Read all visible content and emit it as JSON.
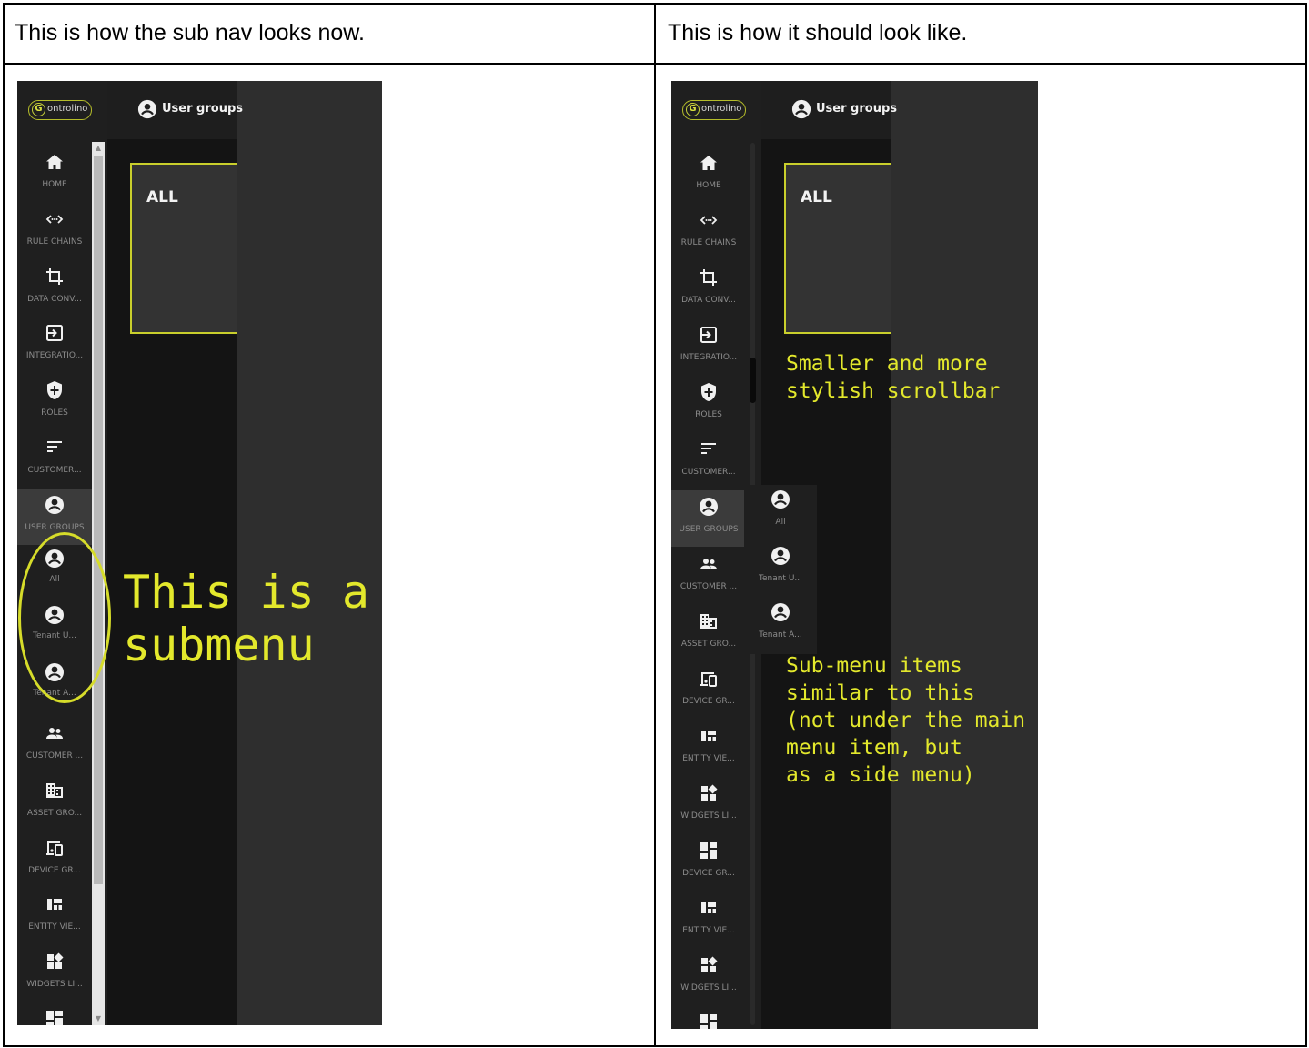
{
  "left_panel": {
    "heading": "This is how the sub nav looks now.",
    "app": {
      "logo_text": "ontrolino",
      "logo_letter": "G",
      "topbar_title": "User groups",
      "card_title": "ALL",
      "nav_items": [
        {
          "label": "HOME",
          "icon": "home-icon"
        },
        {
          "label": "RULE CHAINS",
          "icon": "code-icon"
        },
        {
          "label": "DATA CONV...",
          "icon": "crop-icon"
        },
        {
          "label": "INTEGRATIO...",
          "icon": "input-icon"
        },
        {
          "label": "ROLES",
          "icon": "shield-icon"
        },
        {
          "label": "CUSTOMER...",
          "icon": "sort-icon"
        },
        {
          "label": "USER GROUPS",
          "icon": "account-circle-icon",
          "active": true
        },
        {
          "label": "All",
          "icon": "account-circle-icon"
        },
        {
          "label": "Tenant U...",
          "icon": "account-circle-icon"
        },
        {
          "label": "Tenant A...",
          "icon": "account-circle-icon"
        },
        {
          "label": "CUSTOMER ...",
          "icon": "group-icon"
        },
        {
          "label": "ASSET GRO...",
          "icon": "domain-icon"
        },
        {
          "label": "DEVICE GR...",
          "icon": "devices-icon"
        },
        {
          "label": "ENTITY VIE...",
          "icon": "view-quilt-icon"
        },
        {
          "label": "WIDGETS LI...",
          "icon": "widgets-icon"
        },
        {
          "label": "",
          "icon": "dashboard-icon"
        }
      ]
    },
    "annotation": "This is a\nsubmenu"
  },
  "right_panel": {
    "heading": "This is how it should look like.",
    "app": {
      "logo_text": "ontrolino",
      "logo_letter": "G",
      "topbar_title": "User groups",
      "card_title": "ALL",
      "nav_items": [
        {
          "label": "HOME",
          "icon": "home-icon"
        },
        {
          "label": "RULE CHAINS",
          "icon": "code-icon"
        },
        {
          "label": "DATA CONV...",
          "icon": "crop-icon"
        },
        {
          "label": "INTEGRATIO...",
          "icon": "input-icon"
        },
        {
          "label": "ROLES",
          "icon": "shield-icon"
        },
        {
          "label": "CUSTOMER...",
          "icon": "sort-icon"
        },
        {
          "label": "USER GROUPS",
          "icon": "account-circle-icon",
          "active": true
        },
        {
          "label": "CUSTOMER ...",
          "icon": "group-icon"
        },
        {
          "label": "ASSET GRO...",
          "icon": "domain-icon"
        },
        {
          "label": "DEVICE GR...",
          "icon": "devices-icon"
        },
        {
          "label": "ENTITY VIE...",
          "icon": "view-quilt-icon"
        },
        {
          "label": "WIDGETS LI...",
          "icon": "widgets-icon"
        },
        {
          "label": "DEVICE GR...",
          "icon": "dashboard-icon"
        },
        {
          "label": "ENTITY VIE...",
          "icon": "view-quilt-icon"
        },
        {
          "label": "WIDGETS LI...",
          "icon": "widgets-icon"
        },
        {
          "label": "",
          "icon": "dashboard-icon"
        }
      ],
      "submenu_items": [
        {
          "label": "All",
          "icon": "account-circle-icon"
        },
        {
          "label": "Tenant U...",
          "icon": "account-circle-icon"
        },
        {
          "label": "Tenant A...",
          "icon": "account-circle-icon"
        }
      ]
    },
    "annotation_scrollbar": "Smaller and more\nstylish scrollbar",
    "annotation_submenu": "Sub-menu items\nsimilar to this\n(not under the main\nmenu item, but\nas a side menu)"
  },
  "colors": {
    "annotation": "#e3e82c",
    "sidebar_bg": "#1f1f1f",
    "content_bg": "#2e2e2e",
    "accent_border": "#c9cf2c"
  }
}
